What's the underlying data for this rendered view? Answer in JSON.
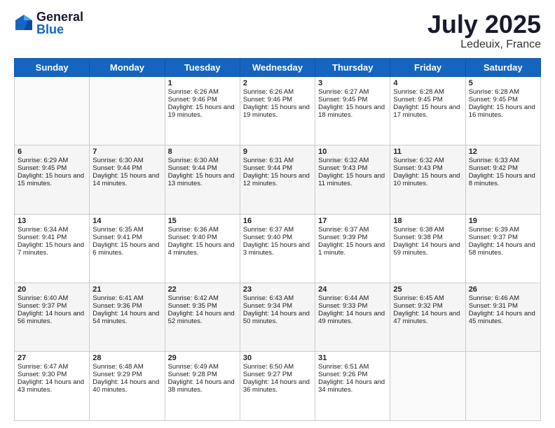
{
  "header": {
    "logo_general": "General",
    "logo_blue": "Blue",
    "title": "July 2025",
    "subtitle": "Ledeuix, France"
  },
  "days_of_week": [
    "Sunday",
    "Monday",
    "Tuesday",
    "Wednesday",
    "Thursday",
    "Friday",
    "Saturday"
  ],
  "weeks": [
    [
      {
        "day": "",
        "info": ""
      },
      {
        "day": "",
        "info": ""
      },
      {
        "day": "1",
        "info": "Sunrise: 6:26 AM\nSunset: 9:46 PM\nDaylight: 15 hours and 19 minutes."
      },
      {
        "day": "2",
        "info": "Sunrise: 6:26 AM\nSunset: 9:46 PM\nDaylight: 15 hours and 19 minutes."
      },
      {
        "day": "3",
        "info": "Sunrise: 6:27 AM\nSunset: 9:45 PM\nDaylight: 15 hours and 18 minutes."
      },
      {
        "day": "4",
        "info": "Sunrise: 6:28 AM\nSunset: 9:45 PM\nDaylight: 15 hours and 17 minutes."
      },
      {
        "day": "5",
        "info": "Sunrise: 6:28 AM\nSunset: 9:45 PM\nDaylight: 15 hours and 16 minutes."
      }
    ],
    [
      {
        "day": "6",
        "info": "Sunrise: 6:29 AM\nSunset: 9:45 PM\nDaylight: 15 hours and 15 minutes."
      },
      {
        "day": "7",
        "info": "Sunrise: 6:30 AM\nSunset: 9:44 PM\nDaylight: 15 hours and 14 minutes."
      },
      {
        "day": "8",
        "info": "Sunrise: 6:30 AM\nSunset: 9:44 PM\nDaylight: 15 hours and 13 minutes."
      },
      {
        "day": "9",
        "info": "Sunrise: 6:31 AM\nSunset: 9:44 PM\nDaylight: 15 hours and 12 minutes."
      },
      {
        "day": "10",
        "info": "Sunrise: 6:32 AM\nSunset: 9:43 PM\nDaylight: 15 hours and 11 minutes."
      },
      {
        "day": "11",
        "info": "Sunrise: 6:32 AM\nSunset: 9:43 PM\nDaylight: 15 hours and 10 minutes."
      },
      {
        "day": "12",
        "info": "Sunrise: 6:33 AM\nSunset: 9:42 PM\nDaylight: 15 hours and 8 minutes."
      }
    ],
    [
      {
        "day": "13",
        "info": "Sunrise: 6:34 AM\nSunset: 9:41 PM\nDaylight: 15 hours and 7 minutes."
      },
      {
        "day": "14",
        "info": "Sunrise: 6:35 AM\nSunset: 9:41 PM\nDaylight: 15 hours and 6 minutes."
      },
      {
        "day": "15",
        "info": "Sunrise: 6:36 AM\nSunset: 9:40 PM\nDaylight: 15 hours and 4 minutes."
      },
      {
        "day": "16",
        "info": "Sunrise: 6:37 AM\nSunset: 9:40 PM\nDaylight: 15 hours and 3 minutes."
      },
      {
        "day": "17",
        "info": "Sunrise: 6:37 AM\nSunset: 9:39 PM\nDaylight: 15 hours and 1 minute."
      },
      {
        "day": "18",
        "info": "Sunrise: 6:38 AM\nSunset: 9:38 PM\nDaylight: 14 hours and 59 minutes."
      },
      {
        "day": "19",
        "info": "Sunrise: 6:39 AM\nSunset: 9:37 PM\nDaylight: 14 hours and 58 minutes."
      }
    ],
    [
      {
        "day": "20",
        "info": "Sunrise: 6:40 AM\nSunset: 9:37 PM\nDaylight: 14 hours and 56 minutes."
      },
      {
        "day": "21",
        "info": "Sunrise: 6:41 AM\nSunset: 9:36 PM\nDaylight: 14 hours and 54 minutes."
      },
      {
        "day": "22",
        "info": "Sunrise: 6:42 AM\nSunset: 9:35 PM\nDaylight: 14 hours and 52 minutes."
      },
      {
        "day": "23",
        "info": "Sunrise: 6:43 AM\nSunset: 9:34 PM\nDaylight: 14 hours and 50 minutes."
      },
      {
        "day": "24",
        "info": "Sunrise: 6:44 AM\nSunset: 9:33 PM\nDaylight: 14 hours and 49 minutes."
      },
      {
        "day": "25",
        "info": "Sunrise: 6:45 AM\nSunset: 9:32 PM\nDaylight: 14 hours and 47 minutes."
      },
      {
        "day": "26",
        "info": "Sunrise: 6:46 AM\nSunset: 9:31 PM\nDaylight: 14 hours and 45 minutes."
      }
    ],
    [
      {
        "day": "27",
        "info": "Sunrise: 6:47 AM\nSunset: 9:30 PM\nDaylight: 14 hours and 43 minutes."
      },
      {
        "day": "28",
        "info": "Sunrise: 6:48 AM\nSunset: 9:29 PM\nDaylight: 14 hours and 40 minutes."
      },
      {
        "day": "29",
        "info": "Sunrise: 6:49 AM\nSunset: 9:28 PM\nDaylight: 14 hours and 38 minutes."
      },
      {
        "day": "30",
        "info": "Sunrise: 6:50 AM\nSunset: 9:27 PM\nDaylight: 14 hours and 36 minutes."
      },
      {
        "day": "31",
        "info": "Sunrise: 6:51 AM\nSunset: 9:26 PM\nDaylight: 14 hours and 34 minutes."
      },
      {
        "day": "",
        "info": ""
      },
      {
        "day": "",
        "info": ""
      }
    ]
  ]
}
